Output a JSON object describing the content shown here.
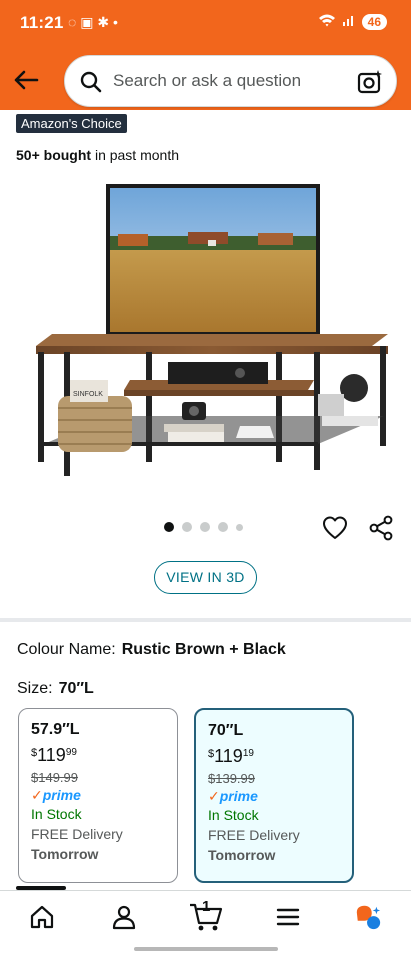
{
  "status_bar": {
    "time": "11:21",
    "battery": "46"
  },
  "header": {
    "search_placeholder": "Search or ask a question"
  },
  "product": {
    "badge": "Amazon's Choice",
    "bought_bold": "50+ bought",
    "bought_rest": " in past month",
    "image_label": "SINFOLK",
    "image_dots": 5,
    "active_dot": 0
  },
  "view_3d_label": "VIEW IN 3D",
  "variations": {
    "colour_label": "Colour Name:",
    "colour_value": "Rustic Brown + Black",
    "size_label": "Size:",
    "size_value": "70″L",
    "options": [
      {
        "length": "57.9″L",
        "currency": "$",
        "price_whole": "119",
        "price_cents": "99",
        "was": "$149.99",
        "prime": "prime",
        "stock": "In Stock",
        "delivery": "FREE Delivery",
        "day": "Tomorrow",
        "selected": false
      },
      {
        "length": "70″L",
        "currency": "$",
        "price_whole": "119",
        "price_cents": "19",
        "was": "$139.99",
        "prime": "prime",
        "stock": "In Stock",
        "delivery": "FREE Delivery",
        "day": "Tomorrow",
        "selected": true
      }
    ]
  },
  "bottom_nav": {
    "items": [
      "home-icon",
      "account-icon",
      "cart-icon",
      "menu-icon",
      "rufus-icon"
    ],
    "cart_count": "1"
  },
  "colors": {
    "brand_orange": "#f2661c",
    "link_teal": "#007185",
    "prime_blue": "#1a98ff",
    "stock_green": "#007600",
    "selected_border": "#24607a"
  }
}
